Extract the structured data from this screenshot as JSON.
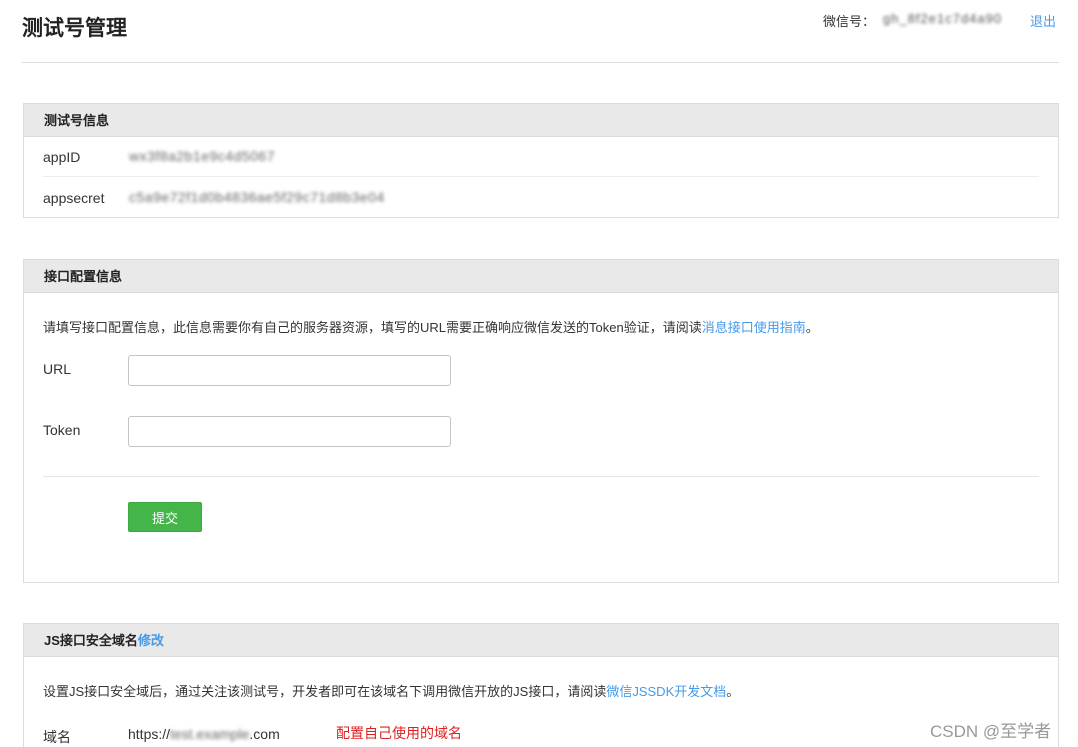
{
  "header": {
    "title": "测试号管理",
    "wechat_label": "微信号：",
    "wechat_value": "gh_8f2e1c7d4a90",
    "logout": "退出"
  },
  "test_account": {
    "title": "测试号信息",
    "appid_label": "appID",
    "appid_value": "wx3f8a2b1e9c4d5067",
    "appsecret_label": "appsecret",
    "appsecret_value": "c5a9e72f1d0b4836ae5f29c71d8b3e04"
  },
  "interface_config": {
    "title": "接口配置信息",
    "desc_text": "请填写接口配置信息，此信息需要你有自己的服务器资源，填写的URL需要正确响应微信发送的Token验证，请阅读",
    "desc_link": "消息接口使用指南",
    "desc_end": "。",
    "url_label": "URL",
    "url_value": "",
    "token_label": "Token",
    "token_value": "",
    "submit_label": "提交"
  },
  "js_domain": {
    "title": "JS接口安全域名",
    "edit_link": "修改",
    "desc_text": "设置JS接口安全域后，通过关注该测试号，开发者即可在该域名下调用微信开放的JS接口，请阅读",
    "desc_link": "微信JSSDK开发文档",
    "desc_end": "。",
    "domain_label": "域名",
    "domain_prefix": "https://",
    "domain_hidden": "test.example",
    "domain_suffix": ".com",
    "domain_note": "配置自己使用的域名"
  },
  "watermark": "CSDN @至学者",
  "colors": {
    "link": "#459ae9",
    "submit_button": "#44b549",
    "note_red": "#e02020",
    "panel_header_bg": "#e9e9e9"
  }
}
